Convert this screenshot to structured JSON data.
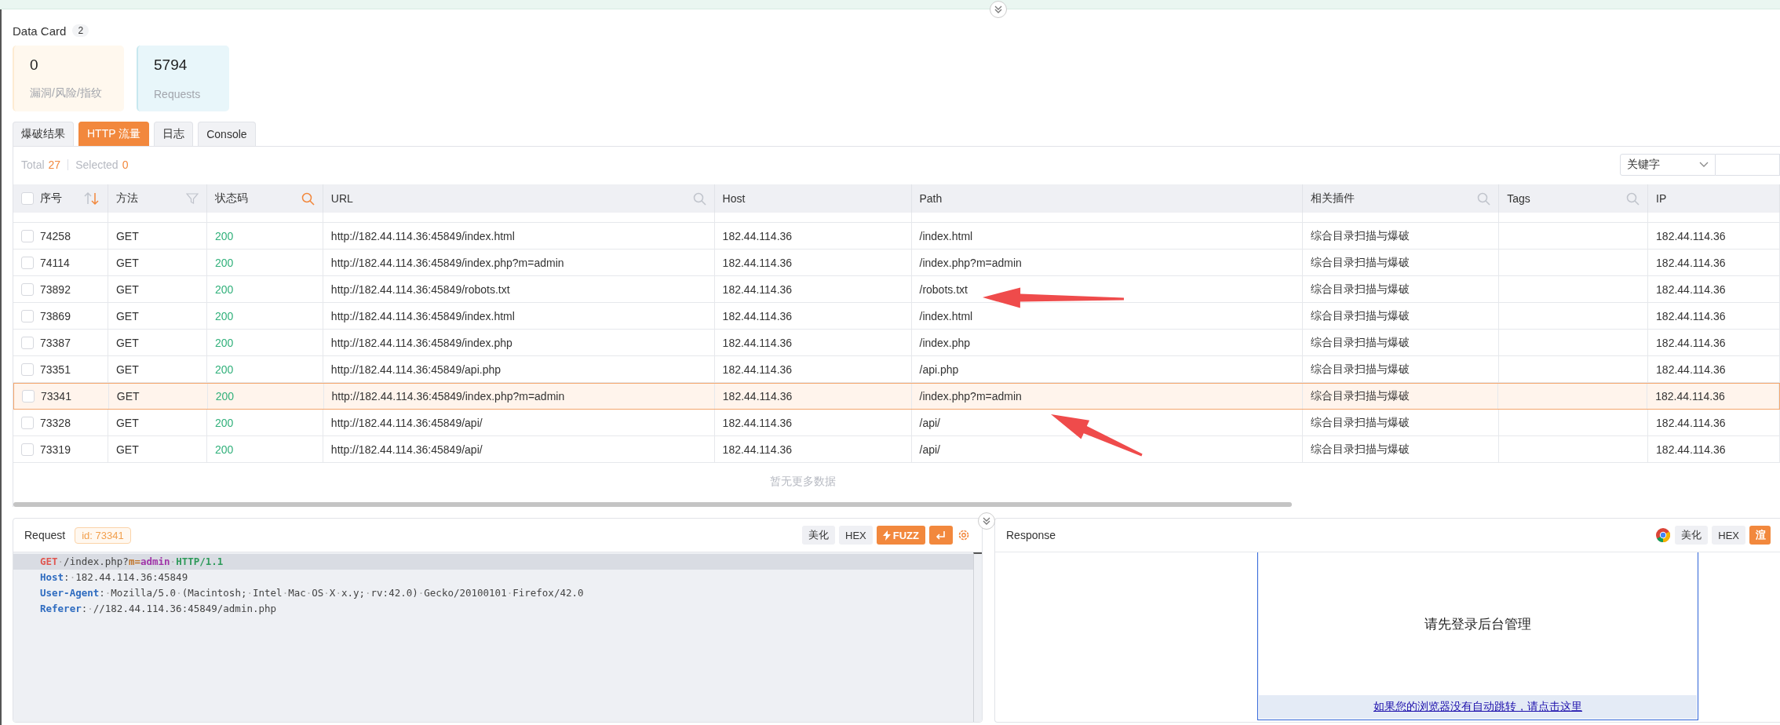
{
  "data_card": {
    "title": "Data Card",
    "count": "2",
    "cards": [
      {
        "value": "0",
        "label": "漏洞/风险/指纹",
        "kind": "findings"
      },
      {
        "value": "5794",
        "label": "Requests",
        "kind": "requests"
      }
    ]
  },
  "tabs": [
    {
      "label": "爆破结果",
      "selected": false
    },
    {
      "label": "HTTP 流量",
      "selected": true
    },
    {
      "label": "日志",
      "selected": false
    },
    {
      "label": "Console",
      "selected": false
    }
  ],
  "summary": {
    "total_label": "Total",
    "total": "27",
    "selected_label": "Selected",
    "selected": "0"
  },
  "search": {
    "field_select": "关键字"
  },
  "table": {
    "columns": [
      {
        "label": "序号",
        "kind": "sort"
      },
      {
        "label": "方法",
        "kind": "filter",
        "active": false
      },
      {
        "label": "状态码",
        "kind": "search",
        "active": true
      },
      {
        "label": "URL",
        "kind": "search",
        "active": false
      },
      {
        "label": "Host",
        "kind": "plain"
      },
      {
        "label": "Path",
        "kind": "plain"
      },
      {
        "label": "相关插件",
        "kind": "search",
        "active": false
      },
      {
        "label": "Tags",
        "kind": "search",
        "active": false
      },
      {
        "label": "IP",
        "kind": "plain"
      }
    ],
    "all_checked": false,
    "rows": [
      {
        "checked": false,
        "id": "74258",
        "method": "GET",
        "status": "200",
        "url": "http://182.44.114.36:45849/index.html",
        "host": "182.44.114.36",
        "path": "/index.html",
        "plugin": "综合目录扫描与爆破",
        "ip": "182.44.114.36",
        "selected": false
      },
      {
        "checked": false,
        "id": "74114",
        "method": "GET",
        "status": "200",
        "url": "http://182.44.114.36:45849/index.php?m=admin",
        "host": "182.44.114.36",
        "path": "/index.php?m=admin",
        "plugin": "综合目录扫描与爆破",
        "ip": "182.44.114.36",
        "selected": false
      },
      {
        "checked": false,
        "id": "73892",
        "method": "GET",
        "status": "200",
        "url": "http://182.44.114.36:45849/robots.txt",
        "host": "182.44.114.36",
        "path": "/robots.txt",
        "plugin": "综合目录扫描与爆破",
        "ip": "182.44.114.36",
        "selected": false
      },
      {
        "checked": false,
        "id": "73869",
        "method": "GET",
        "status": "200",
        "url": "http://182.44.114.36:45849/index.html",
        "host": "182.44.114.36",
        "path": "/index.html",
        "plugin": "综合目录扫描与爆破",
        "ip": "182.44.114.36",
        "selected": false
      },
      {
        "checked": false,
        "id": "73387",
        "method": "GET",
        "status": "200",
        "url": "http://182.44.114.36:45849/index.php",
        "host": "182.44.114.36",
        "path": "/index.php",
        "plugin": "综合目录扫描与爆破",
        "ip": "182.44.114.36",
        "selected": false
      },
      {
        "checked": false,
        "id": "73351",
        "method": "GET",
        "status": "200",
        "url": "http://182.44.114.36:45849/api.php",
        "host": "182.44.114.36",
        "path": "/api.php",
        "plugin": "综合目录扫描与爆破",
        "ip": "182.44.114.36",
        "selected": false
      },
      {
        "checked": false,
        "id": "73341",
        "method": "GET",
        "status": "200",
        "url": "http://182.44.114.36:45849/index.php?m=admin",
        "host": "182.44.114.36",
        "path": "/index.php?m=admin",
        "plugin": "综合目录扫描与爆破",
        "ip": "182.44.114.36",
        "selected": true
      },
      {
        "checked": false,
        "id": "73328",
        "method": "GET",
        "status": "200",
        "url": "http://182.44.114.36:45849/api/",
        "host": "182.44.114.36",
        "path": "/api/",
        "plugin": "综合目录扫描与爆破",
        "ip": "182.44.114.36",
        "selected": false
      },
      {
        "checked": false,
        "id": "73319",
        "method": "GET",
        "status": "200",
        "url": "http://182.44.114.36:45849/api/",
        "host": "182.44.114.36",
        "path": "/api/",
        "plugin": "综合目录扫描与爆破",
        "ip": "182.44.114.36",
        "selected": false
      }
    ],
    "footer": "暂无更多数据"
  },
  "request": {
    "title": "Request",
    "id_badge": "id: 73341",
    "buttons": [
      {
        "label": "美化",
        "kind": "plain"
      },
      {
        "label": "HEX",
        "kind": "plain"
      },
      {
        "label": "FUZZ",
        "kind": "fuzz"
      },
      {
        "kind": "enter"
      }
    ],
    "lines": [
      {
        "current": true,
        "segments": [
          {
            "kind": "method",
            "text": "GET"
          },
          {
            "kind": "text",
            "text": "·/index.php?"
          },
          {
            "kind": "param",
            "text": "m="
          },
          {
            "kind": "value",
            "text": "admin"
          },
          {
            "kind": "text",
            "text": "·"
          },
          {
            "kind": "version",
            "text": "HTTP/1.1"
          }
        ]
      },
      {
        "current": false,
        "segments": [
          {
            "kind": "key",
            "text": "Host"
          },
          {
            "kind": "text",
            "text": ":·182.44.114.36:45849"
          }
        ]
      },
      {
        "current": false,
        "segments": [
          {
            "kind": "key",
            "text": "User-Agent"
          },
          {
            "kind": "text",
            "text": ":·Mozilla/5.0·(Macintosh;·Intel·Mac·OS·X·x.y;·rv:42.0)·Gecko/20100101·Firefox/42.0"
          }
        ]
      },
      {
        "current": false,
        "segments": [
          {
            "kind": "key",
            "text": "Referer"
          },
          {
            "kind": "text",
            "text": ":·//182.44.114.36:45849/admin.php"
          }
        ]
      }
    ]
  },
  "response": {
    "title": "Response",
    "buttons": [
      {
        "label": "美化",
        "kind": "plain"
      },
      {
        "label": "HEX",
        "kind": "plain"
      },
      {
        "label": "渲",
        "kind": "primary"
      }
    ],
    "page": {
      "message": "请先登录后台管理",
      "link": "如果您的浏览器没有自动跳转，请点击这里"
    }
  }
}
